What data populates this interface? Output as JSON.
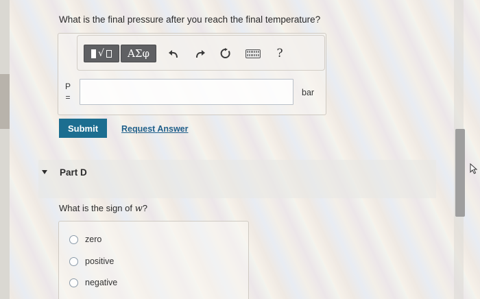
{
  "partC": {
    "question": "What is the final pressure after you reach the final temperature?",
    "variable_top": "P",
    "variable_bottom": "=",
    "input_value": "",
    "unit": "bar",
    "submit_label": "Submit",
    "request_answer_label": "Request Answer"
  },
  "toolbar": {
    "greek_label": "ΑΣφ",
    "sqrt_glyph": "√",
    "help_label": "?",
    "icons": [
      "templates-icon",
      "undo-icon",
      "redo-icon",
      "reset-icon",
      "keyboard-icon",
      "help-icon"
    ]
  },
  "partD": {
    "title": "Part D",
    "question_prefix": "What is the sign of ",
    "question_var": "w",
    "question_suffix": "?",
    "options": [
      {
        "label": "zero"
      },
      {
        "label": "positive"
      },
      {
        "label": "negative"
      }
    ]
  },
  "colors": {
    "submit_bg": "#1c6e90",
    "link": "#1f5f8a",
    "tool_button": "#5f6063"
  }
}
